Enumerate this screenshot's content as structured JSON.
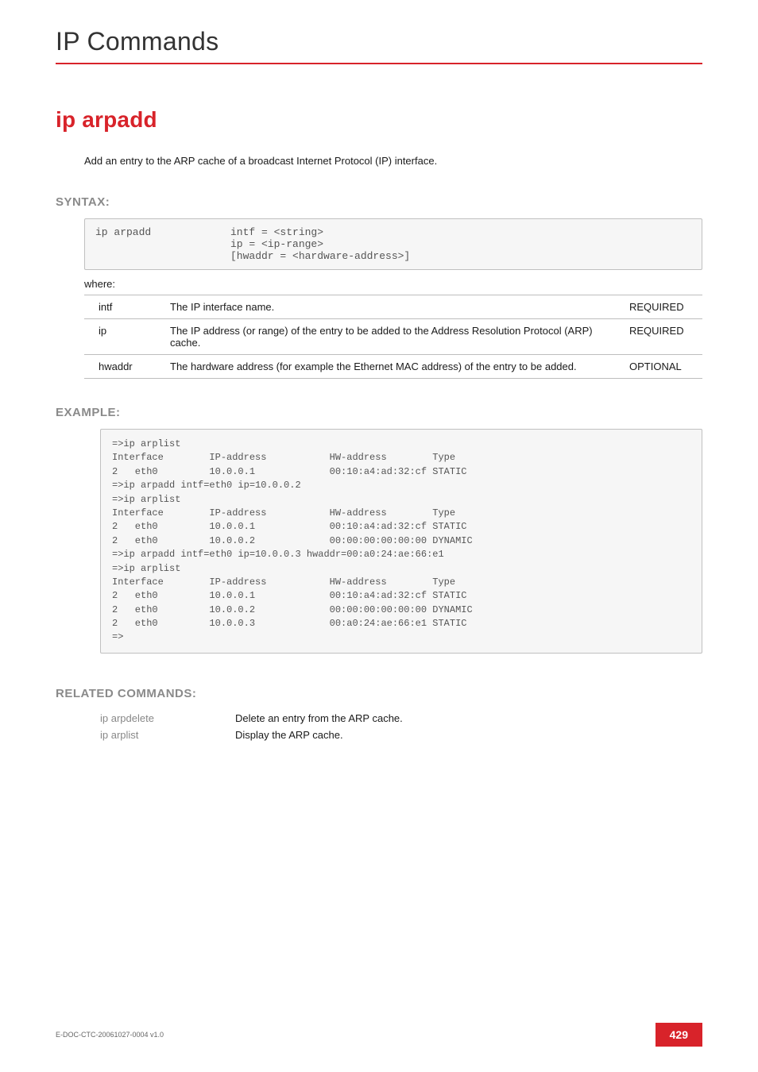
{
  "chapter": {
    "title": "IP Commands"
  },
  "command": {
    "title": "ip arpadd",
    "description": "Add an entry to the ARP cache of a broadcast Internet Protocol (IP) interface."
  },
  "syntax": {
    "heading": "SYNTAX:",
    "command": "ip arpadd",
    "args": "intf = <string>\nip = <ip-range>\n[hwaddr = <hardware-address>]",
    "where": "where:",
    "params": [
      {
        "name": "intf",
        "desc": "The IP interface name.",
        "req": "REQUIRED"
      },
      {
        "name": "ip",
        "desc": "The IP address (or range) of the entry to be added to the Address Resolution Protocol (ARP) cache.",
        "req": "REQUIRED"
      },
      {
        "name": "hwaddr",
        "desc": "The hardware address (for example the Ethernet MAC address) of the entry to be added.",
        "req": "OPTIONAL"
      }
    ]
  },
  "example": {
    "heading": "EXAMPLE:",
    "text": "=>ip arplist\nInterface        IP-address           HW-address        Type\n2   eth0         10.0.0.1             00:10:a4:ad:32:cf STATIC\n=>ip arpadd intf=eth0 ip=10.0.0.2\n=>ip arplist\nInterface        IP-address           HW-address        Type\n2   eth0         10.0.0.1             00:10:a4:ad:32:cf STATIC\n2   eth0         10.0.0.2             00:00:00:00:00:00 DYNAMIC\n=>ip arpadd intf=eth0 ip=10.0.0.3 hwaddr=00:a0:24:ae:66:e1\n=>ip arplist\nInterface        IP-address           HW-address        Type\n2   eth0         10.0.0.1             00:10:a4:ad:32:cf STATIC\n2   eth0         10.0.0.2             00:00:00:00:00:00 DYNAMIC\n2   eth0         10.0.0.3             00:a0:24:ae:66:e1 STATIC\n=>"
  },
  "related": {
    "heading": "RELATED COMMANDS:",
    "items": [
      {
        "name": "ip arpdelete",
        "desc": "Delete an entry from the ARP cache."
      },
      {
        "name": "ip arplist",
        "desc": "Display the ARP cache."
      }
    ]
  },
  "footer": {
    "docid": "E-DOC-CTC-20061027-0004 v1.0",
    "pagenum": "429"
  }
}
